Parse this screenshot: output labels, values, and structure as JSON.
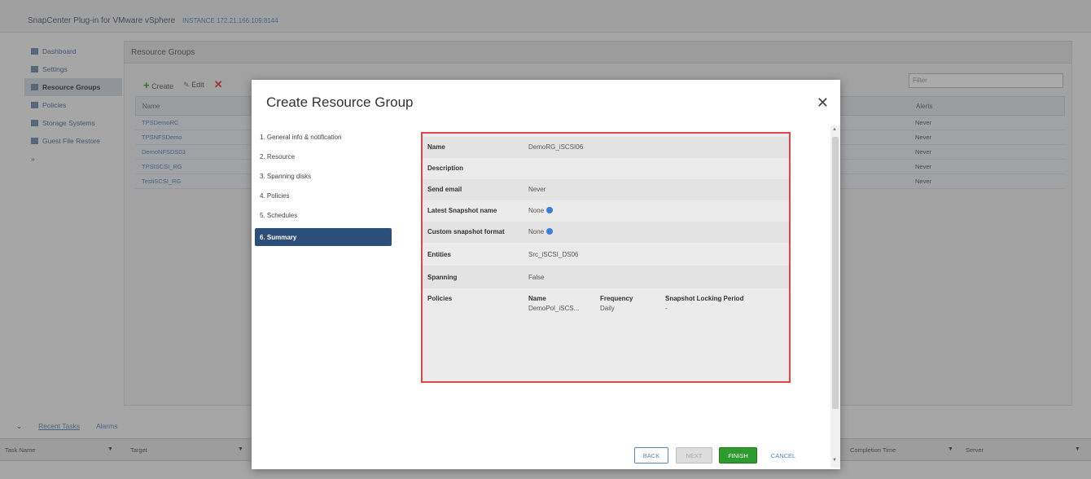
{
  "app": {
    "title": "SnapCenter Plug-in for VMware vSphere",
    "instance": "INSTANCE 172.21.166.109:8144"
  },
  "sidebar": {
    "items": [
      {
        "label": "Dashboard"
      },
      {
        "label": "Settings"
      },
      {
        "label": "Resource Groups"
      },
      {
        "label": "Policies"
      },
      {
        "label": "Storage Systems"
      },
      {
        "label": "Guest File Restore"
      }
    ],
    "collapse": "»"
  },
  "resource_groups": {
    "title": "Resource Groups",
    "toolbar": {
      "create": "Create",
      "edit": "Edit"
    },
    "filter_placeholder": "Filter",
    "col_name": "Name",
    "col_alerts": "Alerts",
    "rows": [
      "TPSDemoRC",
      "TPSNFSDemo",
      "DemoNFSDS03",
      "TPSISCSI_RG",
      "TestiSCSI_RG"
    ],
    "alerts": [
      "Never",
      "Never",
      "Never",
      "Never",
      "Never"
    ]
  },
  "bottom": {
    "tabs": [
      "Recent Tasks",
      "Alarms"
    ],
    "columns": [
      "Task Name",
      "Target",
      "Completion Time",
      "Server"
    ]
  },
  "modal": {
    "title": "Create Resource Group",
    "steps": [
      "1. General info & notification",
      "2. Resource",
      "3. Spanning disks",
      "4. Policies",
      "5. Schedules",
      "6. Summary"
    ],
    "active_step": 5,
    "summary": {
      "name_label": "Name",
      "name_value": "DemoRG_iSCSI06",
      "description_label": "Description",
      "description_value": "",
      "send_email_label": "Send email",
      "send_email_value": "Never",
      "latest_snapshot_label": "Latest Snapshot name",
      "latest_snapshot_value": "None",
      "custom_snapshot_label": "Custom snapshot format",
      "custom_snapshot_value": "None",
      "entities_label": "Entities",
      "entities_value": "Src_iSCSI_DS06",
      "spanning_label": "Spanning",
      "spanning_value": "False",
      "policies_label": "Policies",
      "policy_headers": [
        "Name",
        "Frequency",
        "Snapshot Locking Period"
      ],
      "policy_row": [
        "DemoPol_iSCS...",
        "Daily",
        "-"
      ]
    },
    "buttons": {
      "back": "BACK",
      "next": "NEXT",
      "finish": "FINISH",
      "cancel": "CANCEL"
    }
  }
}
